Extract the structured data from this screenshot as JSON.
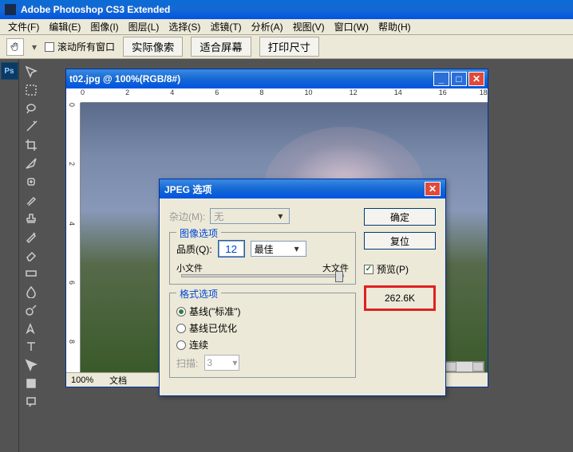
{
  "app": {
    "title": "Adobe Photoshop CS3 Extended"
  },
  "menu": {
    "file": "文件(F)",
    "edit": "编辑(E)",
    "image": "图像(I)",
    "layer": "图层(L)",
    "select": "选择(S)",
    "filter": "滤镜(T)",
    "analysis": "分析(A)",
    "view": "视图(V)",
    "window": "窗口(W)",
    "help": "帮助(H)"
  },
  "toolbar": {
    "scroll_all": "滚动所有窗口",
    "actual_pixels": "实际像索",
    "fit_screen": "适合屏幕",
    "print_size": "打印尺寸"
  },
  "ps_badge": "Ps",
  "doc": {
    "title": "t02.jpg @ 100%(RGB/8#)",
    "zoom": "100%",
    "status_label": "文档",
    "ruler_h": [
      "0",
      "2",
      "4",
      "6",
      "8",
      "10",
      "12",
      "14",
      "16",
      "18"
    ],
    "ruler_v": [
      "0",
      "2",
      "4",
      "6",
      "8"
    ]
  },
  "dialog": {
    "title": "JPEG 选项",
    "matte_label": "杂边(M):",
    "matte_value": "无",
    "image_options_legend": "图像选项",
    "quality_label": "品质(Q):",
    "quality_value": "12",
    "quality_preset": "最佳",
    "small_file": "小文件",
    "large_file": "大文件",
    "format_options_legend": "格式选项",
    "baseline_standard": "基线(\"标准\")",
    "baseline_optimized": "基线已优化",
    "progressive": "连续",
    "scans_label": "扫描:",
    "scans_value": "3",
    "ok": "确定",
    "reset": "复位",
    "preview": "预览(P)",
    "file_size": "262.6K"
  }
}
